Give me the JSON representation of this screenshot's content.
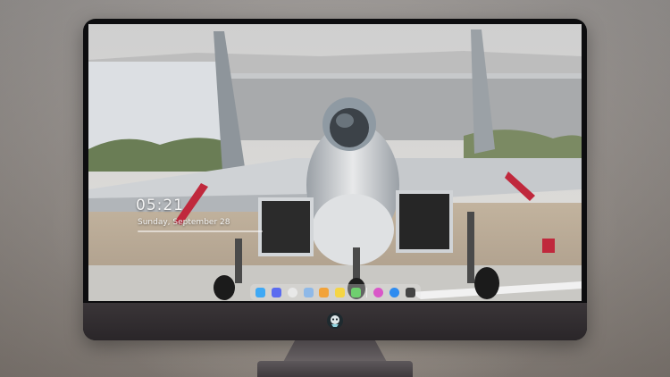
{
  "lock_screen": {
    "time": "05:21",
    "date": "Sunday, September 28"
  },
  "dock": {
    "apps": [
      {
        "icon": "finder-icon",
        "color": "#3fa9f5"
      },
      {
        "icon": "launchpad-icon",
        "color": "#5b6cf0"
      },
      {
        "icon": "safari-icon",
        "color": "#e8e8e8"
      },
      {
        "icon": "preview-icon",
        "color": "#8fb9e8"
      },
      {
        "icon": "photos-icon",
        "color": "#f2a33a"
      },
      {
        "icon": "notes-icon",
        "color": "#f5d545"
      },
      {
        "icon": "maps-icon",
        "color": "#6fcf6f"
      },
      {
        "icon": "itunes-icon",
        "color": "#d957c8"
      },
      {
        "icon": "app-store-icon",
        "color": "#2f8cf0"
      },
      {
        "icon": "camera-icon",
        "color": "#444444"
      }
    ]
  },
  "colors": {
    "bezel": "#0d0d0f",
    "chin": "#2f2a2d",
    "sky": "#d6d6d6",
    "runway": "#b9ad9e"
  }
}
